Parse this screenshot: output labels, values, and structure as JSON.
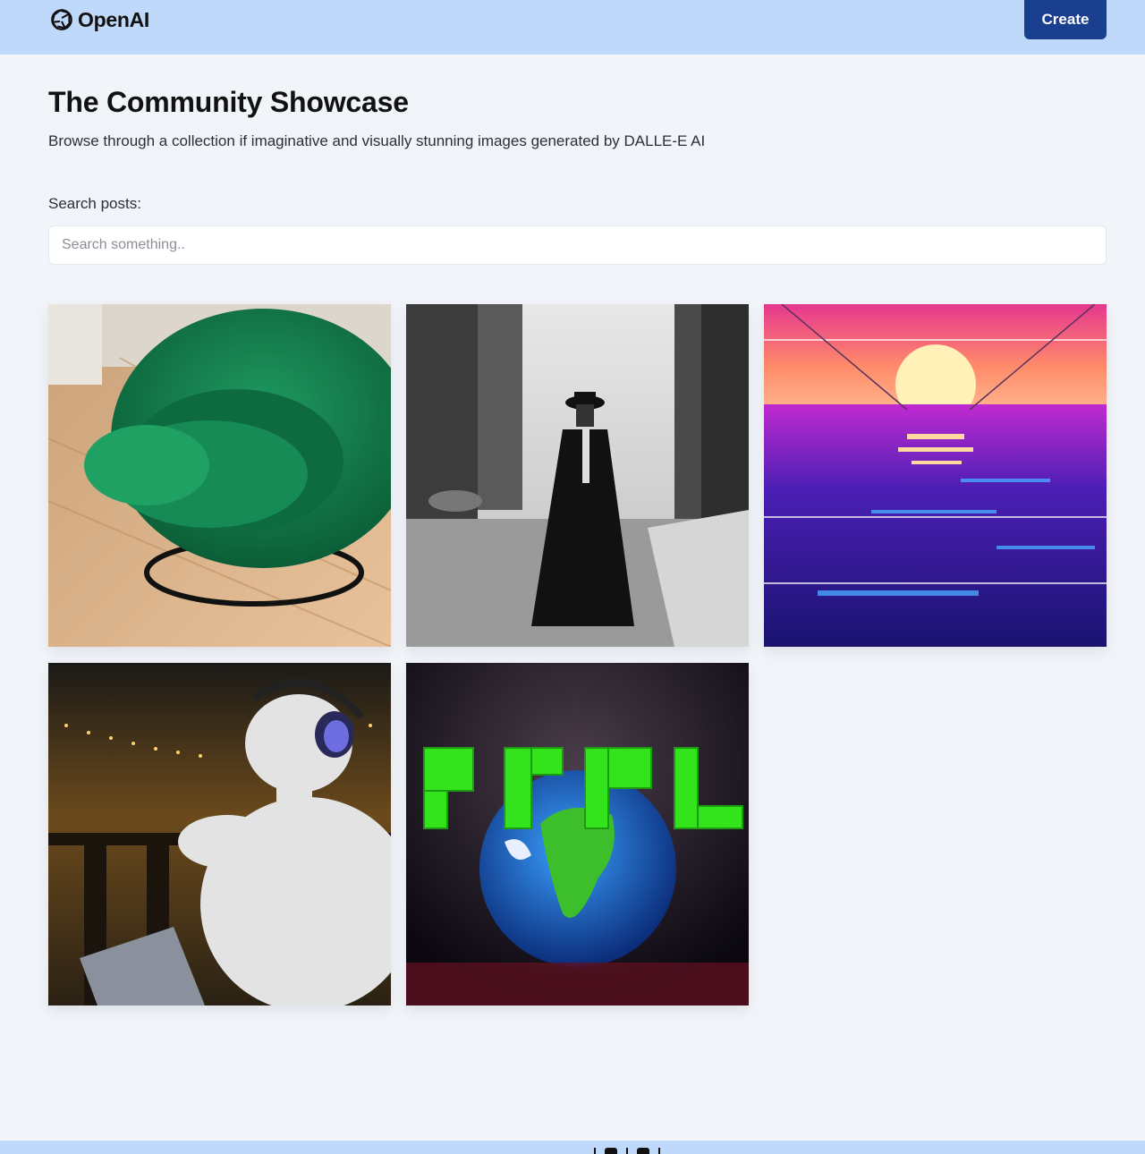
{
  "header": {
    "brand": "OpenAI",
    "logo_icon": "openai-knot-icon",
    "create_label": "Create",
    "colors": {
      "header_bg": "#bfd9fb",
      "create_bg": "#1b3f8f"
    }
  },
  "main": {
    "title": "The Community Showcase",
    "subtitle": "Browse through a collection if imaginative and visually stunning images generated by DALLE-E AI",
    "search": {
      "label": "Search posts:",
      "placeholder": "Search something..",
      "value": ""
    }
  },
  "posts": [
    {
      "image": "green-velvet-egg-chair"
    },
    {
      "image": "black-white-man-walking-city-street"
    },
    {
      "image": "synthwave-sunset-over-sea"
    },
    {
      "image": "statue-with-headphones-and-laptop"
    },
    {
      "image": "earth-with-green-text"
    }
  ],
  "footer": {
    "icons": [
      "github-icon",
      "linkedin-icon",
      "twitter-icon"
    ],
    "colors": {
      "footer_bg": "#bfd9fb"
    }
  }
}
